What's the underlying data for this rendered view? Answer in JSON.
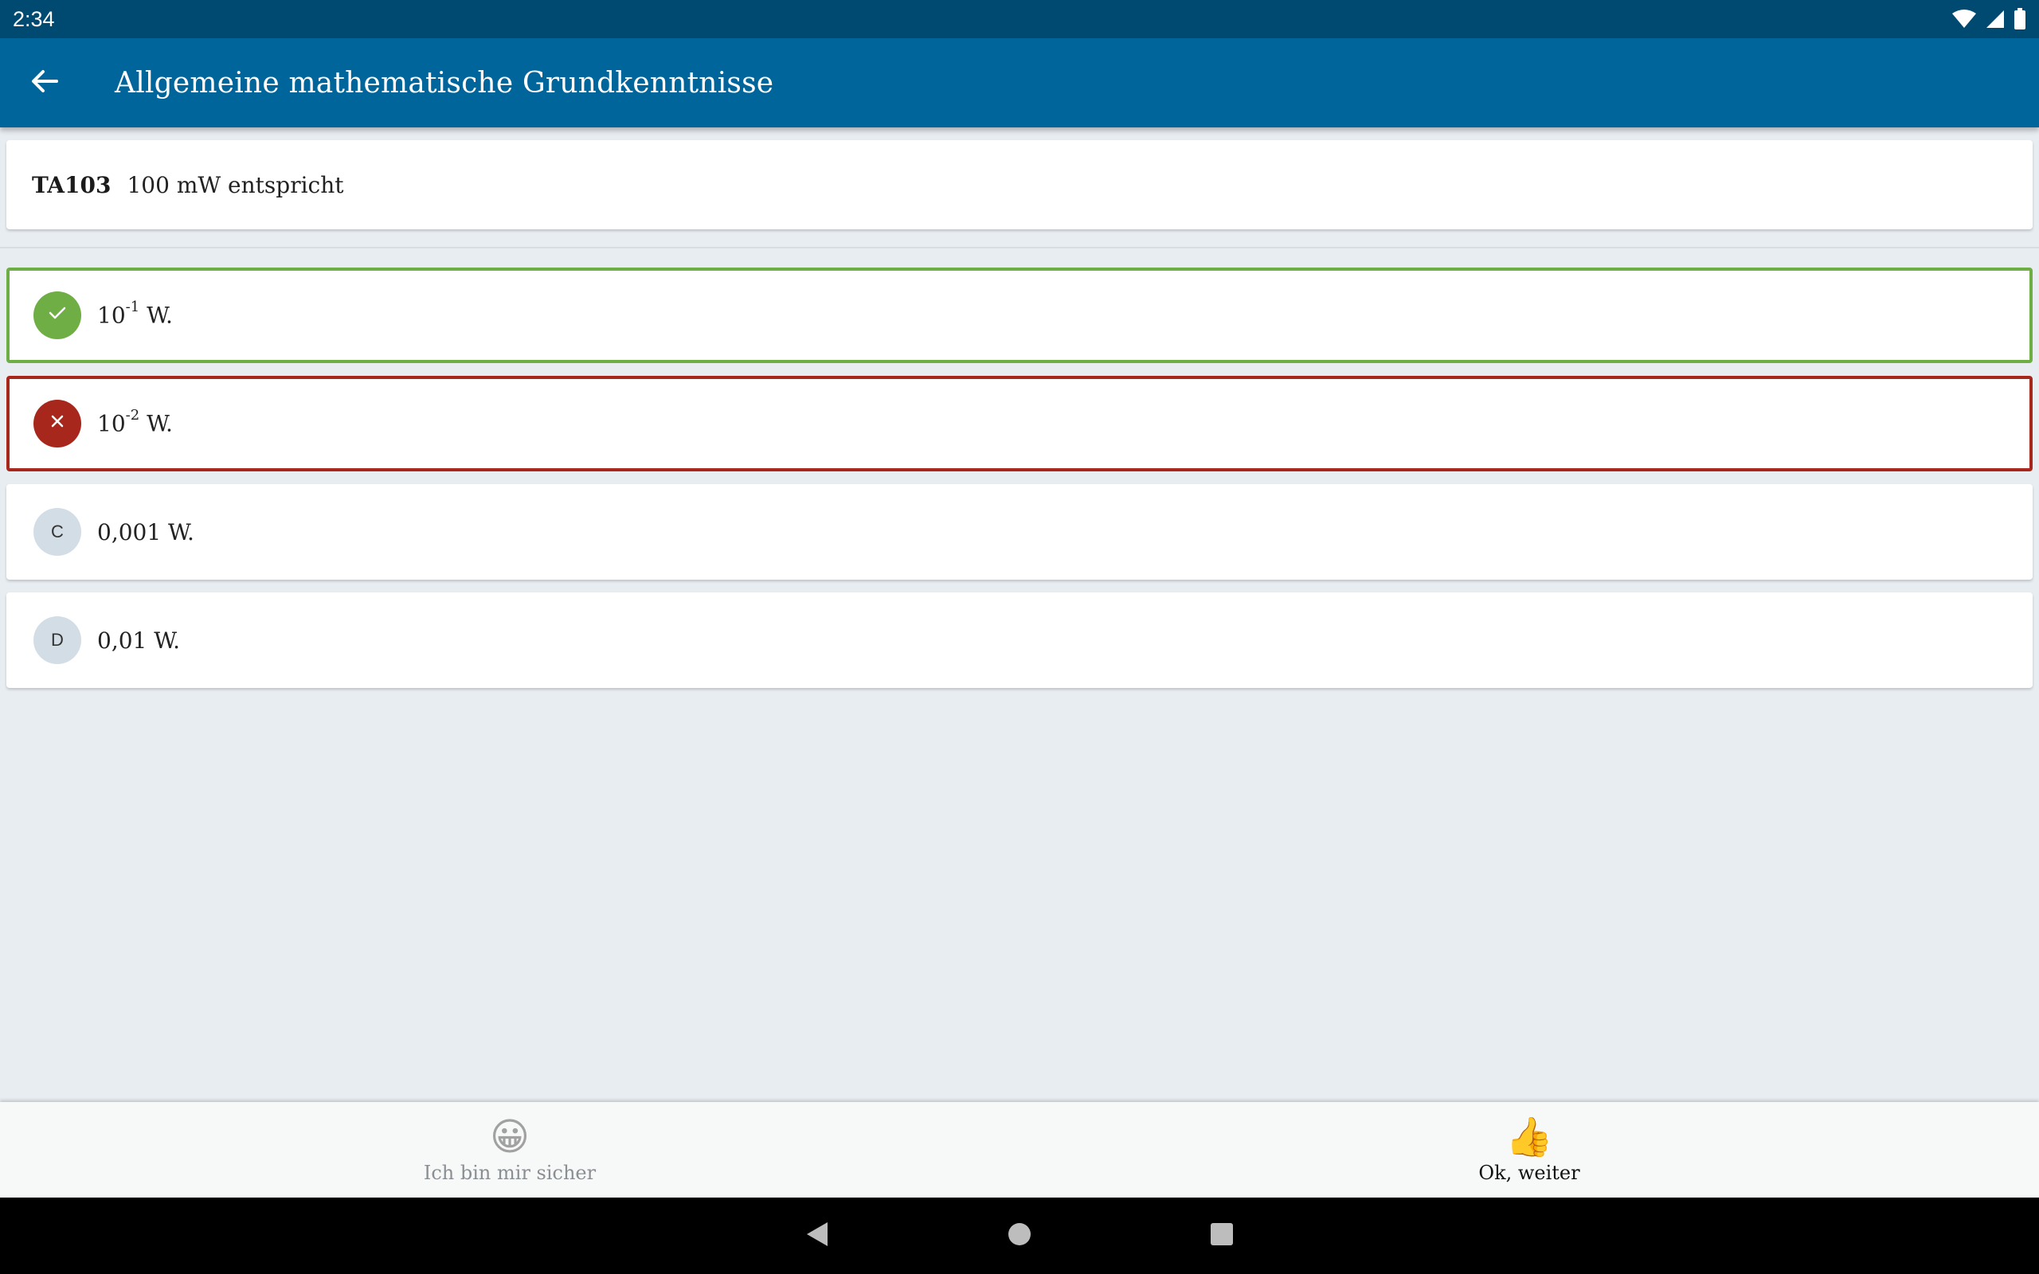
{
  "status_bar": {
    "time": "2:34",
    "icons": [
      "wifi-icon",
      "signal-icon",
      "battery-icon"
    ]
  },
  "app_bar": {
    "back_icon": "arrow-back-icon",
    "title": "Allgemeine mathematische Grundkenntnisse"
  },
  "question": {
    "id": "TA103",
    "text": "100 mW entspricht"
  },
  "answers": [
    {
      "state": "correct",
      "badge_icon": "check-icon",
      "base": "10",
      "exponent": "-1",
      "suffix": " W."
    },
    {
      "state": "wrong",
      "badge_icon": "close-icon",
      "base": "10",
      "exponent": "-2",
      "suffix": " W."
    },
    {
      "state": "neutral",
      "badge_letter": "C",
      "text": "0,001 W."
    },
    {
      "state": "neutral",
      "badge_letter": "D",
      "text": "0,01 W."
    }
  ],
  "bottom_actions": [
    {
      "emoji": "😀",
      "icon": "grinning-face-icon",
      "label": "Ich bin mir sicher",
      "enabled": false
    },
    {
      "emoji": "👍",
      "icon": "thumbs-up-icon",
      "label": "Ok, weiter",
      "enabled": true
    }
  ],
  "nav_bar": {
    "icons": [
      "back-triangle-icon",
      "home-circle-icon",
      "recents-square-icon"
    ]
  },
  "colors": {
    "status_bar": "#004a72",
    "app_bar": "#00659b",
    "correct": "#6fae44",
    "wrong": "#a8271c",
    "background": "#e8edf1"
  }
}
